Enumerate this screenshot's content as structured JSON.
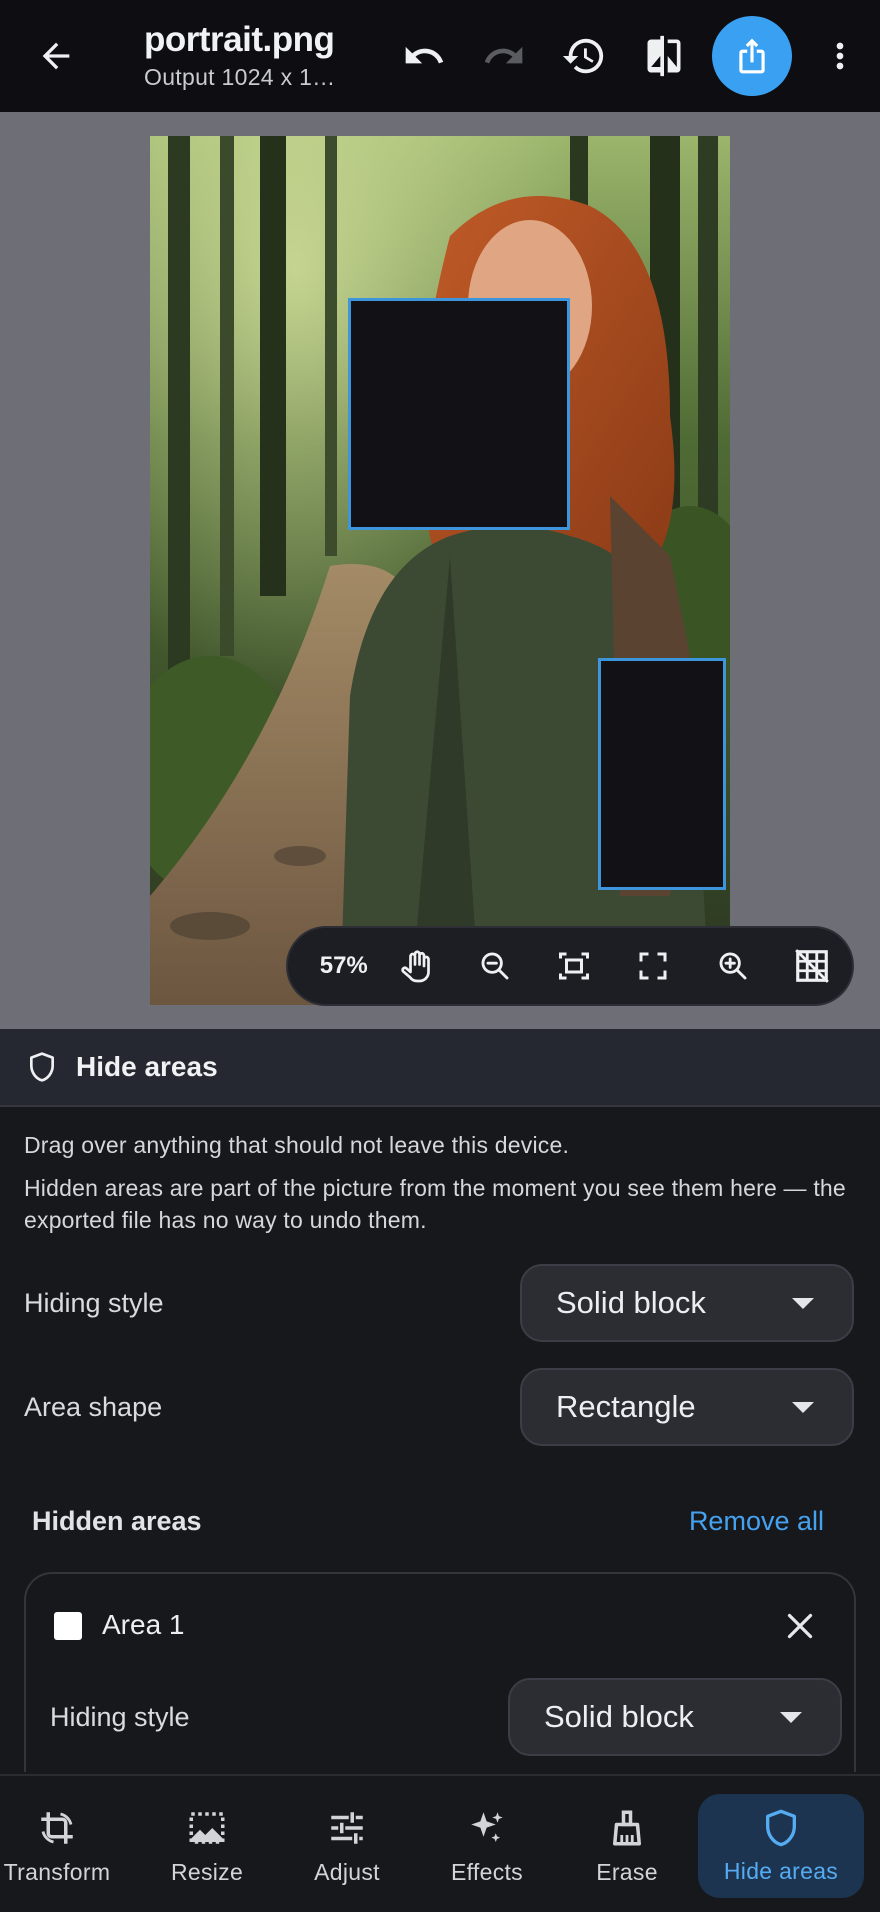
{
  "header": {
    "title": "portrait.png",
    "subtitle": "Output 1024 x 1…"
  },
  "zoom": {
    "level": "57%"
  },
  "panel": {
    "title": "Hide areas",
    "description_1": "Drag over anything that should not leave this device.",
    "description_2": "Hidden areas are part of the picture from the moment you see them here — the exported file has no way to undo them.",
    "hiding_style_label": "Hiding style",
    "hiding_style_value": "Solid block",
    "area_shape_label": "Area shape",
    "area_shape_value": "Rectangle",
    "hidden_areas_title": "Hidden areas",
    "remove_all": "Remove all",
    "areas": [
      {
        "name": "Area 1",
        "swatch_color": "#ffffff",
        "style_label": "Hiding style",
        "style_value": "Solid block"
      }
    ]
  },
  "nav": [
    {
      "label": "Transform",
      "icon": "crop-rotate-icon"
    },
    {
      "label": "Resize",
      "icon": "resize-image-icon"
    },
    {
      "label": "Adjust",
      "icon": "sliders-icon"
    },
    {
      "label": "Effects",
      "icon": "sparkles-icon"
    },
    {
      "label": "Erase",
      "icon": "broom-icon"
    },
    {
      "label": "Hide areas",
      "icon": "shield-icon",
      "active": true
    }
  ],
  "colors": {
    "accent": "#3aa0f2",
    "hide_fill": "#111116",
    "hide_border": "#3d95dc"
  }
}
